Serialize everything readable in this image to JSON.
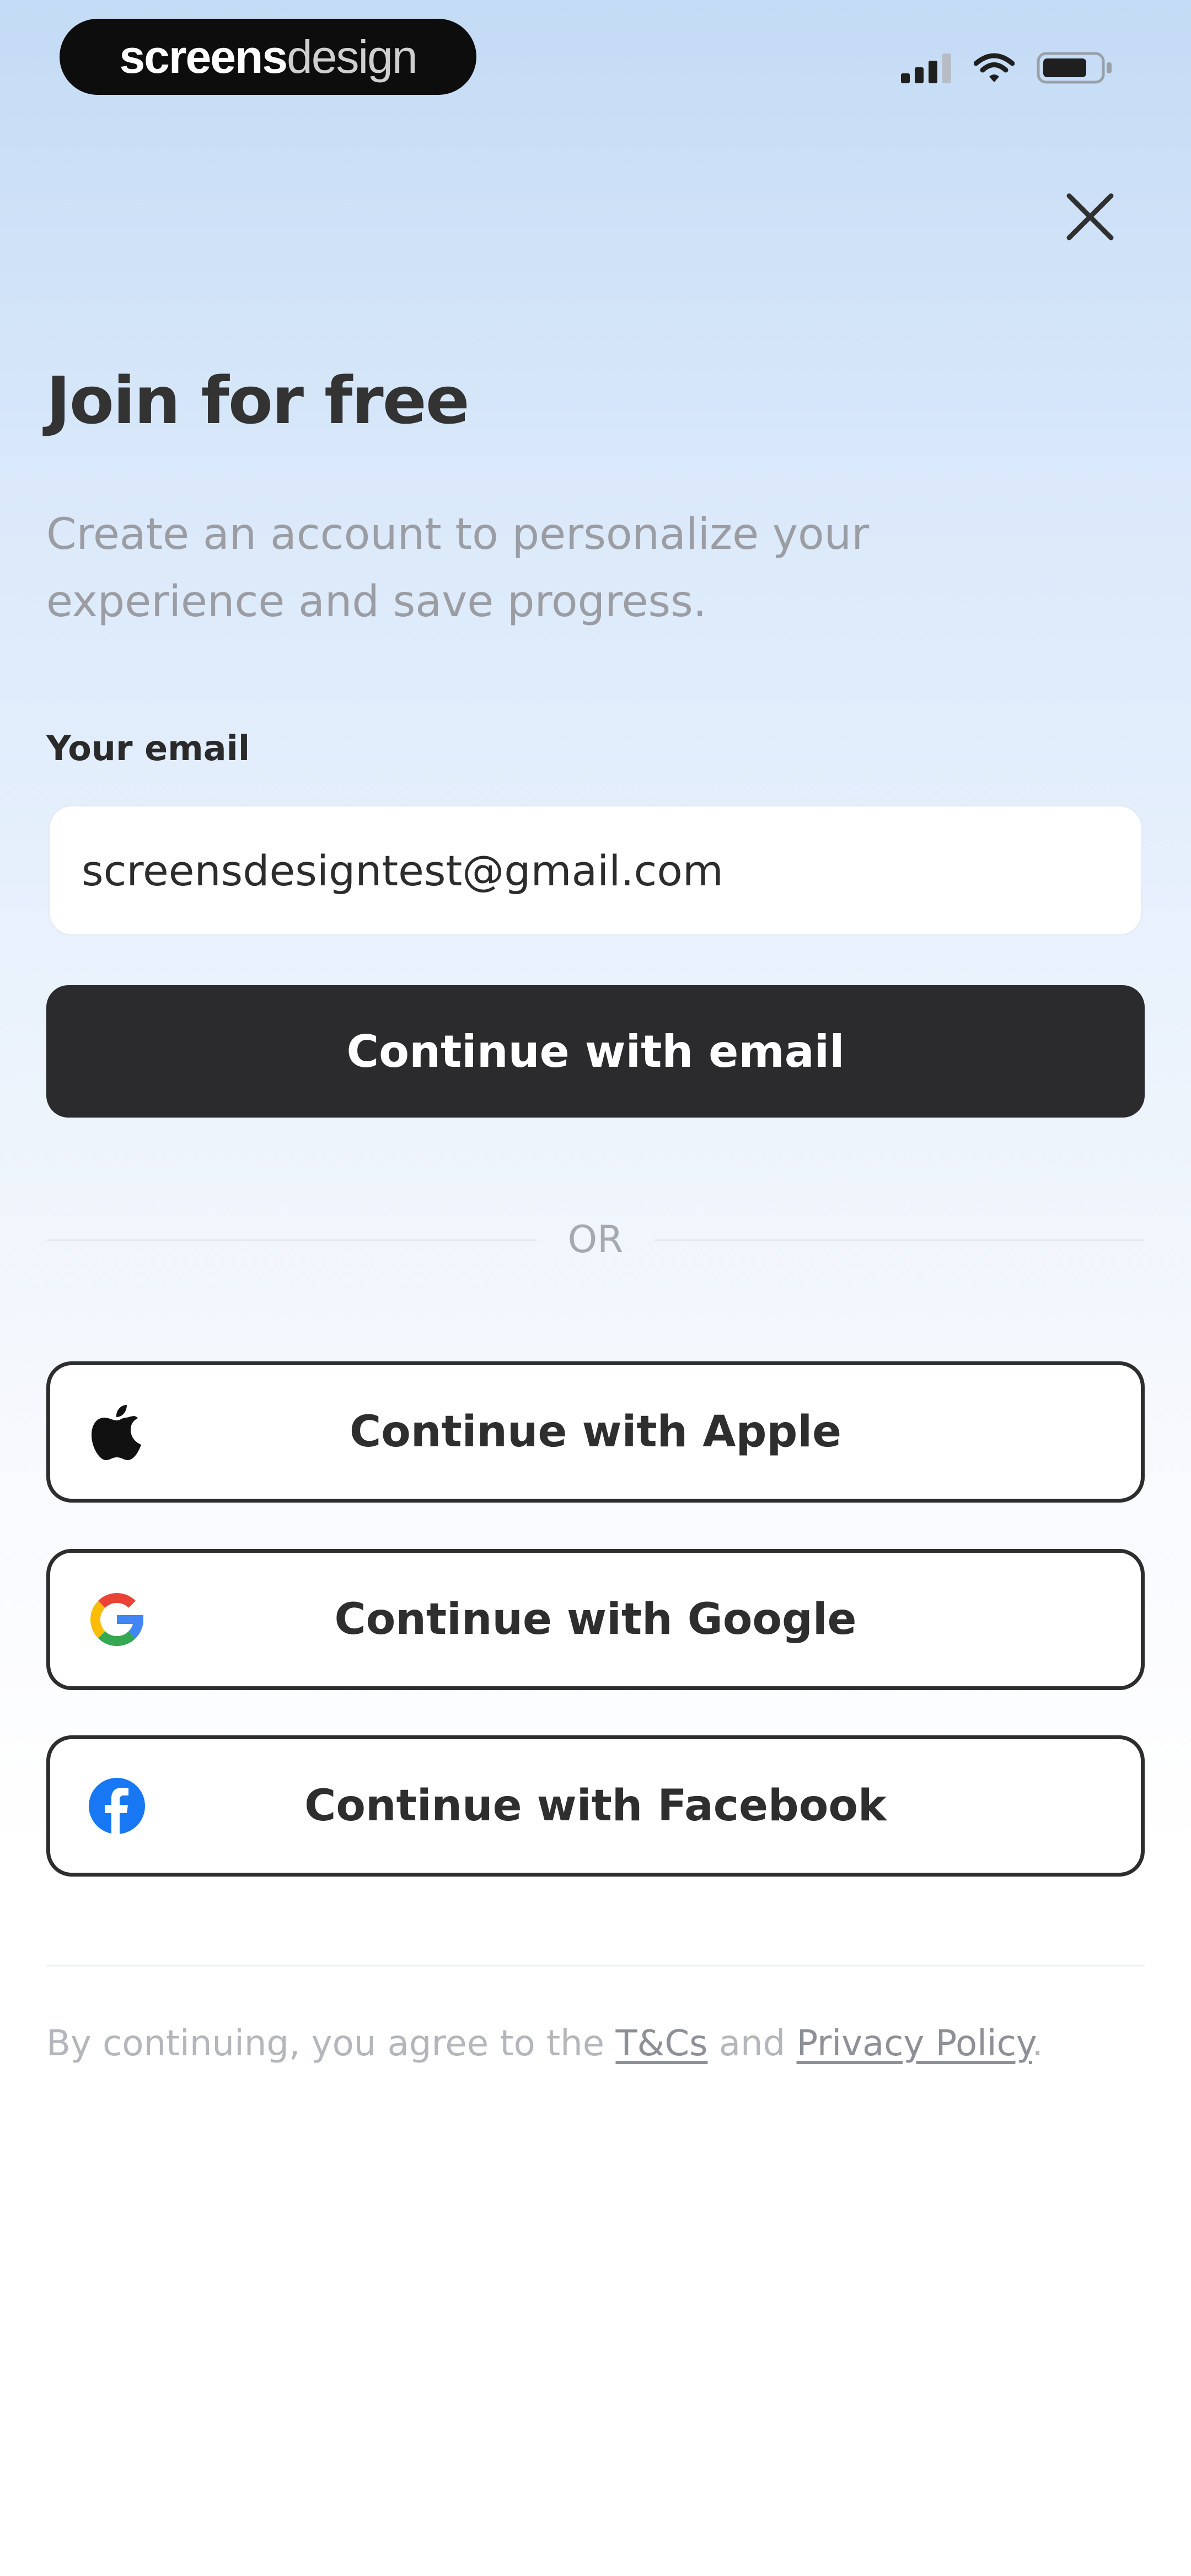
{
  "status_bar": {
    "brand_part1": "screens",
    "brand_part2": "design",
    "icons": [
      "cellular-signal-icon",
      "wifi-icon",
      "battery-icon"
    ]
  },
  "header": {
    "close_icon": "close-icon"
  },
  "title": "Join for free",
  "subtitle": "Create an account to personalize your experience and save progress.",
  "email_form": {
    "label": "Your email",
    "value": "screensdesigntest@gmail.com",
    "submit_label": "Continue with email"
  },
  "divider_text": "OR",
  "social_buttons": [
    {
      "label": "Continue with Apple",
      "icon": "apple-icon"
    },
    {
      "label": "Continue with Google",
      "icon": "google-icon"
    },
    {
      "label": "Continue with Facebook",
      "icon": "facebook-icon"
    }
  ],
  "legal": {
    "prefix": "By continuing, you agree to the ",
    "terms_link": "T&Cs",
    "middle": " and ",
    "privacy_link": "Privacy Policy",
    "suffix": "."
  },
  "colors": {
    "primary_button": "#2b2b2d",
    "background_top": "#c4dbf5",
    "background_bottom": "#ffffff",
    "facebook_blue": "#1877f2",
    "google_blue": "#4285f4",
    "google_red": "#ea4335",
    "google_yellow": "#fbbc05",
    "google_green": "#34a853"
  }
}
